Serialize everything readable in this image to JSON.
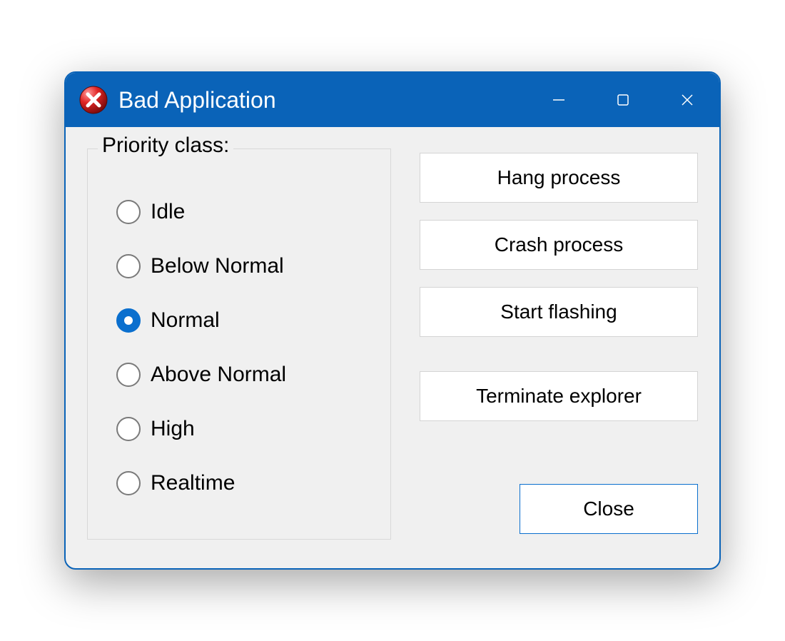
{
  "window": {
    "title": "Bad Application"
  },
  "group": {
    "legend": "Priority class:"
  },
  "priority": {
    "options": [
      {
        "label": "Idle",
        "checked": false
      },
      {
        "label": "Below Normal",
        "checked": false
      },
      {
        "label": "Normal",
        "checked": true
      },
      {
        "label": "Above Normal",
        "checked": false
      },
      {
        "label": "High",
        "checked": false
      },
      {
        "label": "Realtime",
        "checked": false
      }
    ]
  },
  "buttons": {
    "hang": "Hang process",
    "crash": "Crash process",
    "flash": "Start flashing",
    "terminate": "Terminate explorer",
    "close": "Close"
  },
  "colors": {
    "accent": "#0a63b8",
    "radio_checked": "#0a6fce",
    "window_bg": "#f0f0f0"
  }
}
